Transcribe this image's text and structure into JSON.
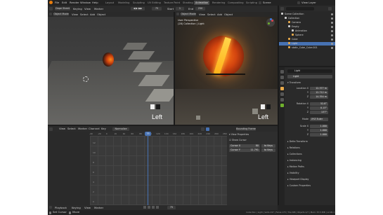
{
  "menu": {
    "file": "File",
    "edit": "Edit",
    "render": "Render",
    "window": "Window",
    "help": "Help"
  },
  "workspaces": [
    "Layout",
    "Modeling",
    "Sculpting",
    "UV Editing",
    "Texture Paint",
    "Shading",
    "Animation",
    "Rendering",
    "Compositing",
    "Scripting"
  ],
  "active_workspace": "Animation",
  "scene_label": "Scene",
  "view_layer_label": "View Layer",
  "timeline_header": {
    "editor": "Dope Sheet",
    "keying": "Keying",
    "view": "View",
    "marker": "Marker",
    "frame": "75",
    "start_label": "Start",
    "start": "1",
    "end_label": "End",
    "end": "250"
  },
  "viewport_left": {
    "mode": "Object Mode",
    "view": "View",
    "select": "Select",
    "add": "Add",
    "object": "Object",
    "hud": "Left"
  },
  "viewport_right": {
    "mode": "Object Mode",
    "view": "View",
    "select": "Select",
    "add": "Add",
    "object": "Object",
    "overlay_line1": "User Perspective",
    "overlay_line2": "(28) Collection | Light",
    "hud": "Left"
  },
  "outliner": {
    "title": "Scene Collection",
    "items": [
      {
        "label": "Scene Collection",
        "depth": 0,
        "color": "#cfcfcf"
      },
      {
        "label": "Collection",
        "depth": 1,
        "color": "#cfcfcf"
      },
      {
        "label": "Camera",
        "depth": 2,
        "color": "#e8a94a"
      },
      {
        "label": "Empty",
        "depth": 2,
        "color": "#cfcfcf"
      },
      {
        "label": "Animation",
        "depth": 3,
        "color": "#cfcfcf"
      },
      {
        "label": "Sphere",
        "depth": 3,
        "color": "#e8a94a"
      },
      {
        "label": "Cube",
        "depth": 2,
        "color": "#e8a94a"
      },
      {
        "label": "Light",
        "depth": 2,
        "color": "#e8a94a",
        "selected": true
      },
      {
        "label": "static_Cube_Cube.001",
        "depth": 2,
        "color": "#e8a94a"
      }
    ]
  },
  "properties": {
    "object_name": "Light",
    "object_name2": "Light",
    "transform_label": "Transform",
    "location_label": "Location X",
    "loc": [
      "12.377 m",
      "12.712 m",
      "14.354 m"
    ],
    "rotation_label": "Rotation X",
    "rot": [
      "52.8°",
      "0.13°",
      "137°"
    ],
    "mode_label": "Mode",
    "mode_value": "XYZ Euler",
    "scale_label": "Scale X",
    "scale": [
      "1.000",
      "1.000",
      "1.000"
    ],
    "y": "Y",
    "z": "Z",
    "sections": [
      "Delta Transform",
      "Relations",
      "Collections",
      "Instancing",
      "Motion Paths",
      "Visibility",
      "Viewport Display",
      "Custom Properties"
    ]
  },
  "graph_editor": {
    "editor": "Graph Editor",
    "view": "View",
    "select": "Select",
    "marker": "Marker",
    "channel": "Channel",
    "key": "Key",
    "normalize": "Normalize",
    "pivot": "Bounding Frame",
    "frame_ticks": [
      "-40",
      "-20",
      "0",
      "20",
      "40",
      "60",
      "80",
      "100",
      "120",
      "140",
      "160",
      "180",
      "200",
      "220",
      "240",
      "260",
      "280"
    ],
    "current_frame": "75",
    "y_ticks": [
      "12",
      "10",
      "8",
      "6",
      "4",
      "2",
      "0"
    ],
    "panel_title": "View Properties",
    "panel_sub": "Show Cursor",
    "cursor_x_label": "Cursor X",
    "cursor_x": "80",
    "cursor_y_label": "Cursor Y",
    "cursor_y": "11.791",
    "to_keys": "to Keys",
    "to_keys2": "to Keys"
  },
  "bottom": {
    "playback": "Playback",
    "keying": "Keying",
    "view": "View",
    "marker": "Marker",
    "select": "Set Cursor",
    "move": "Move",
    "status_right": "Collection | Light | Verts:197 | Faces:173 | Tris:298 | Objects:1/7 | Mem: 33.5 MiB | v2.90.1",
    "frame": "75"
  },
  "colors": {
    "accent": "#4772b3",
    "selected_row": "#4772b3",
    "orange_glow": "#ff9a1a",
    "sphere_red": "#b0301a"
  }
}
